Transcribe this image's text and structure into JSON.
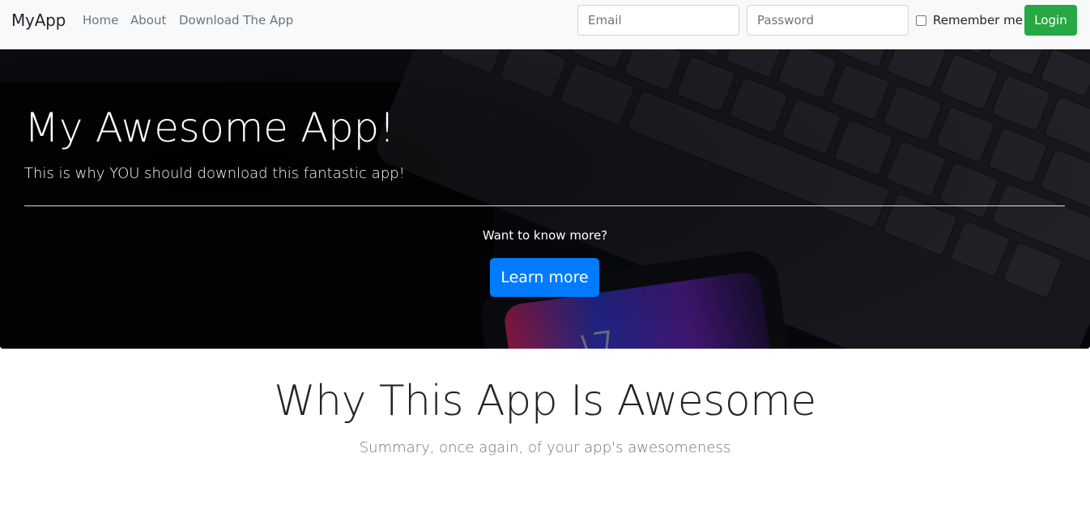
{
  "navbar": {
    "brand": "MyApp",
    "links": [
      "Home",
      "About",
      "Download The App"
    ],
    "email_placeholder": "Email",
    "password_placeholder": "Password",
    "remember_label": "Remember me",
    "remember_checked": false,
    "login_label": "Login",
    "colors": {
      "background": "#f8f9fa",
      "login": "#28a745"
    }
  },
  "hero": {
    "title": "My Awesome App!",
    "subtitle": "This is why YOU should download this fantastic app!",
    "question": "Want to know more?",
    "button_label": "Learn more",
    "background_image": "dark-keyboard-and-phone-photo",
    "colors": {
      "button": "#007bff"
    }
  },
  "section": {
    "title": "Why This App Is Awesome",
    "subtitle": "Summary, once again, of your app's awesomeness"
  }
}
